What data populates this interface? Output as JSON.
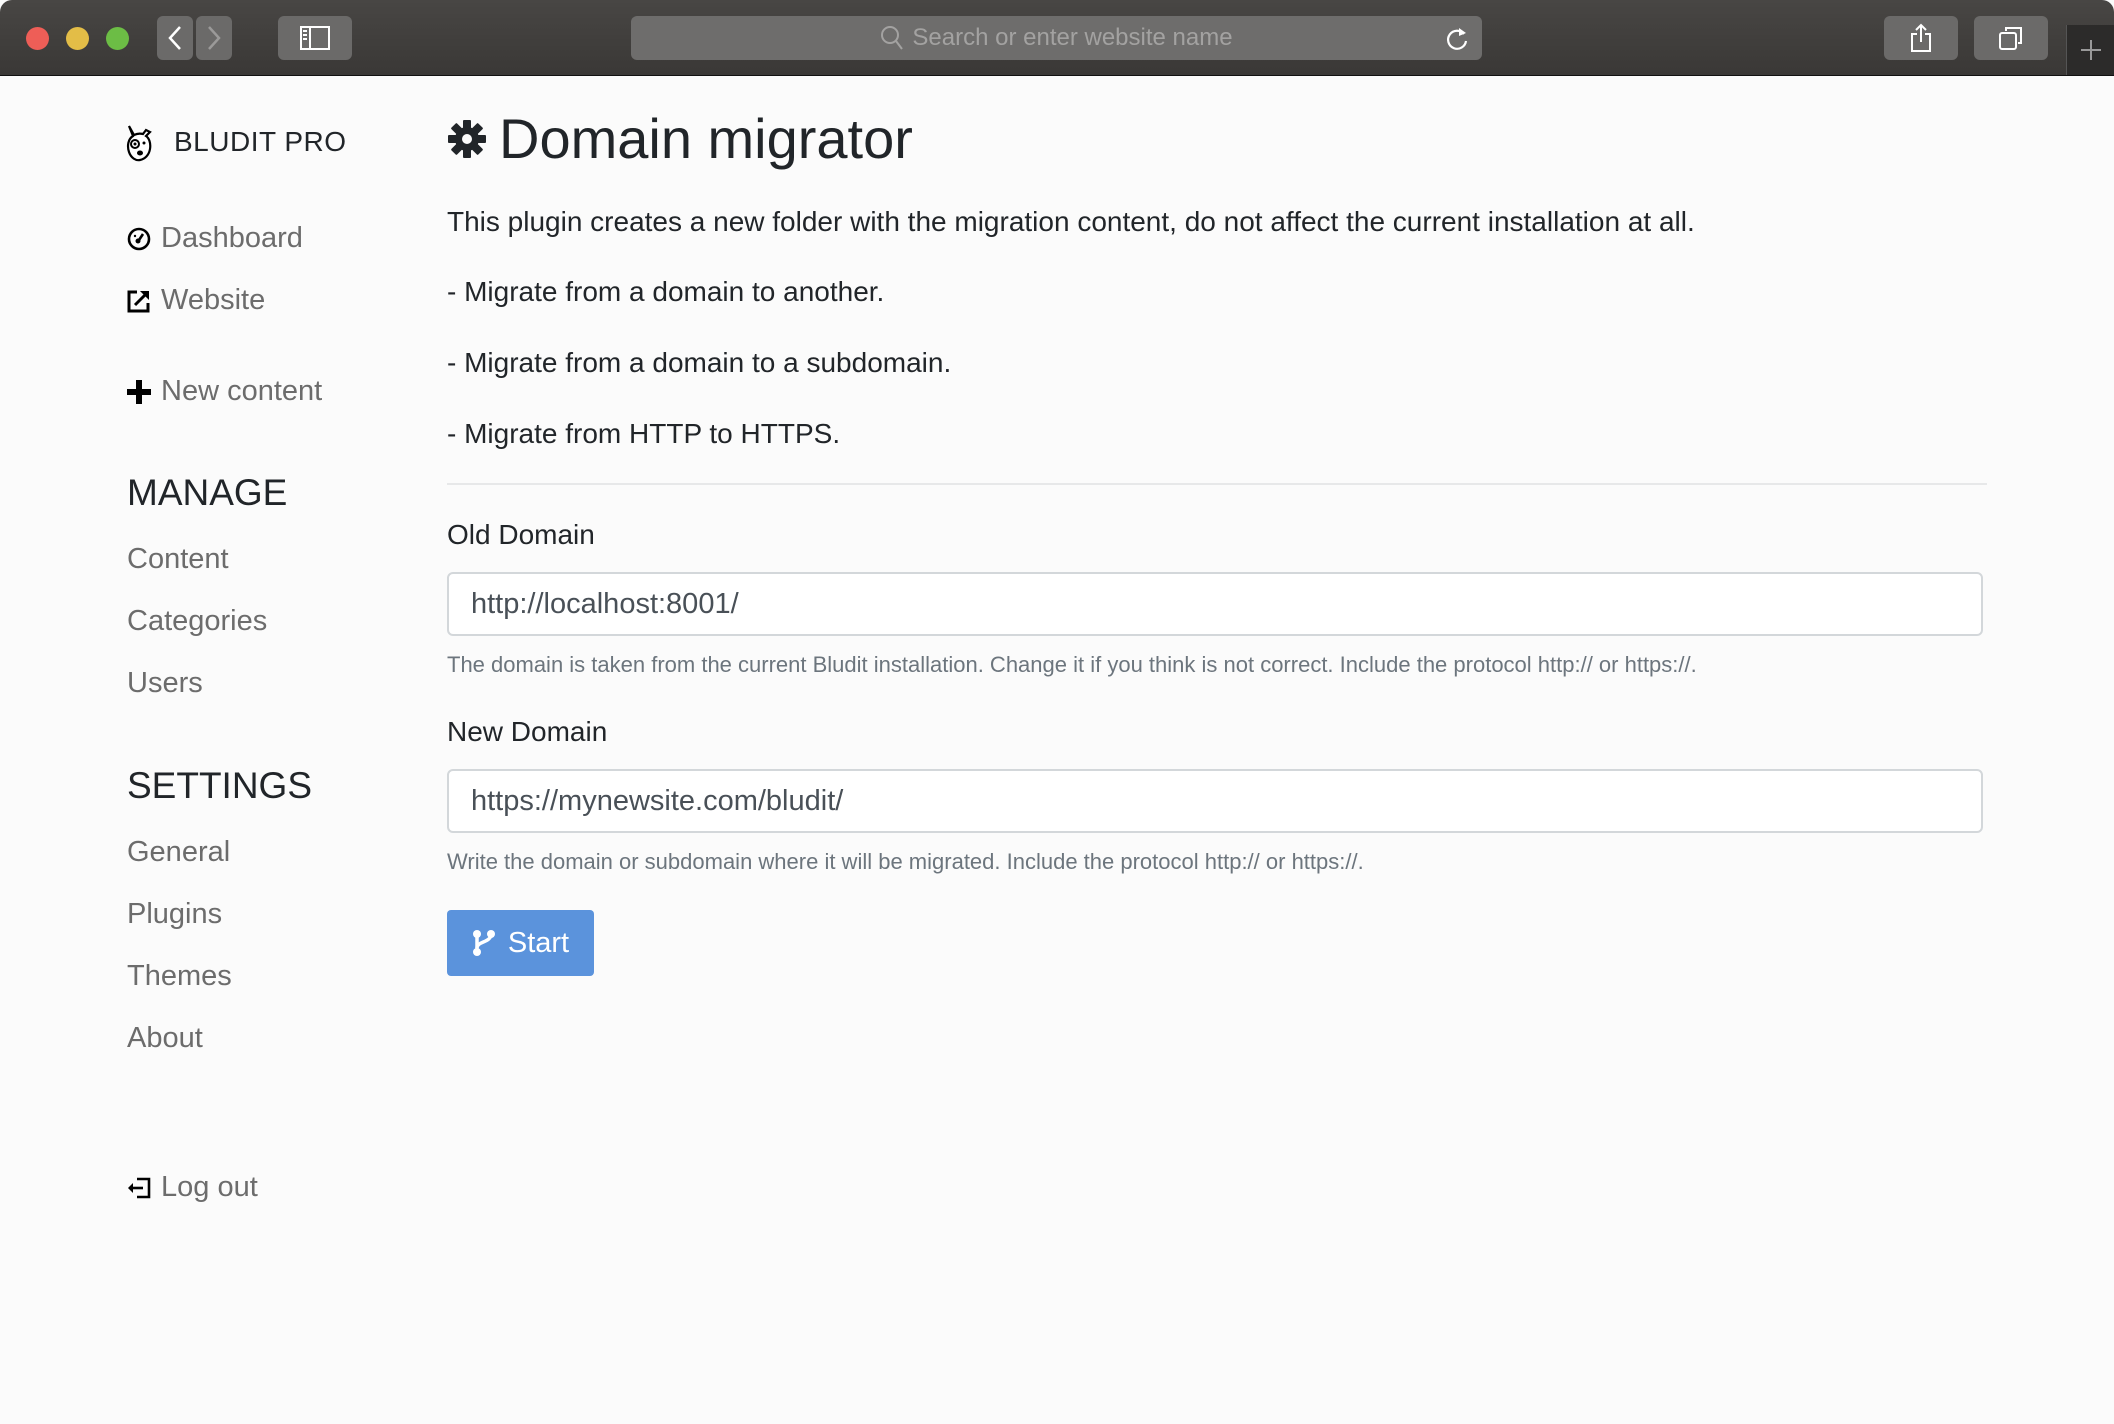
{
  "browser": {
    "search_placeholder": "Search or enter website name",
    "colors": {
      "close": "#ee5e57",
      "minimize": "#e3bd47",
      "maximize": "#6cbd45"
    }
  },
  "sidebar": {
    "brand": "BLUDIT PRO",
    "top_items": [
      {
        "label": "Dashboard",
        "icon": "dashboard-icon"
      },
      {
        "label": "Website",
        "icon": "external-link-icon"
      },
      {
        "label": "New content",
        "icon": "plus-icon"
      }
    ],
    "manage": {
      "heading": "MANAGE",
      "items": [
        "Content",
        "Categories",
        "Users"
      ]
    },
    "settings": {
      "heading": "SETTINGS",
      "items": [
        "General",
        "Plugins",
        "Themes",
        "About"
      ]
    },
    "logout": {
      "label": "Log out",
      "icon": "logout-icon"
    }
  },
  "main": {
    "title": "Domain migrator",
    "title_icon": "gear-icon",
    "description": "This plugin creates a new folder with the migration content, do not affect the current installation at all.",
    "bullets": [
      "- Migrate from a domain to another.",
      "- Migrate from a domain to a subdomain.",
      "- Migrate from HTTP to HTTPS."
    ],
    "old_domain": {
      "label": "Old Domain",
      "value": "http://localhost:8001/",
      "help": "The domain is taken from the current Bludit installation. Change it if you think is not correct. Include the protocol http:// or https://."
    },
    "new_domain": {
      "label": "New Domain",
      "value": "https://mynewsite.com/bludit/",
      "help": "Write the domain or subdomain where it will be migrated. Include the protocol http:// or https://."
    },
    "start_button": {
      "label": "Start",
      "icon": "code-branch-icon",
      "color": "#5b93dc"
    }
  }
}
